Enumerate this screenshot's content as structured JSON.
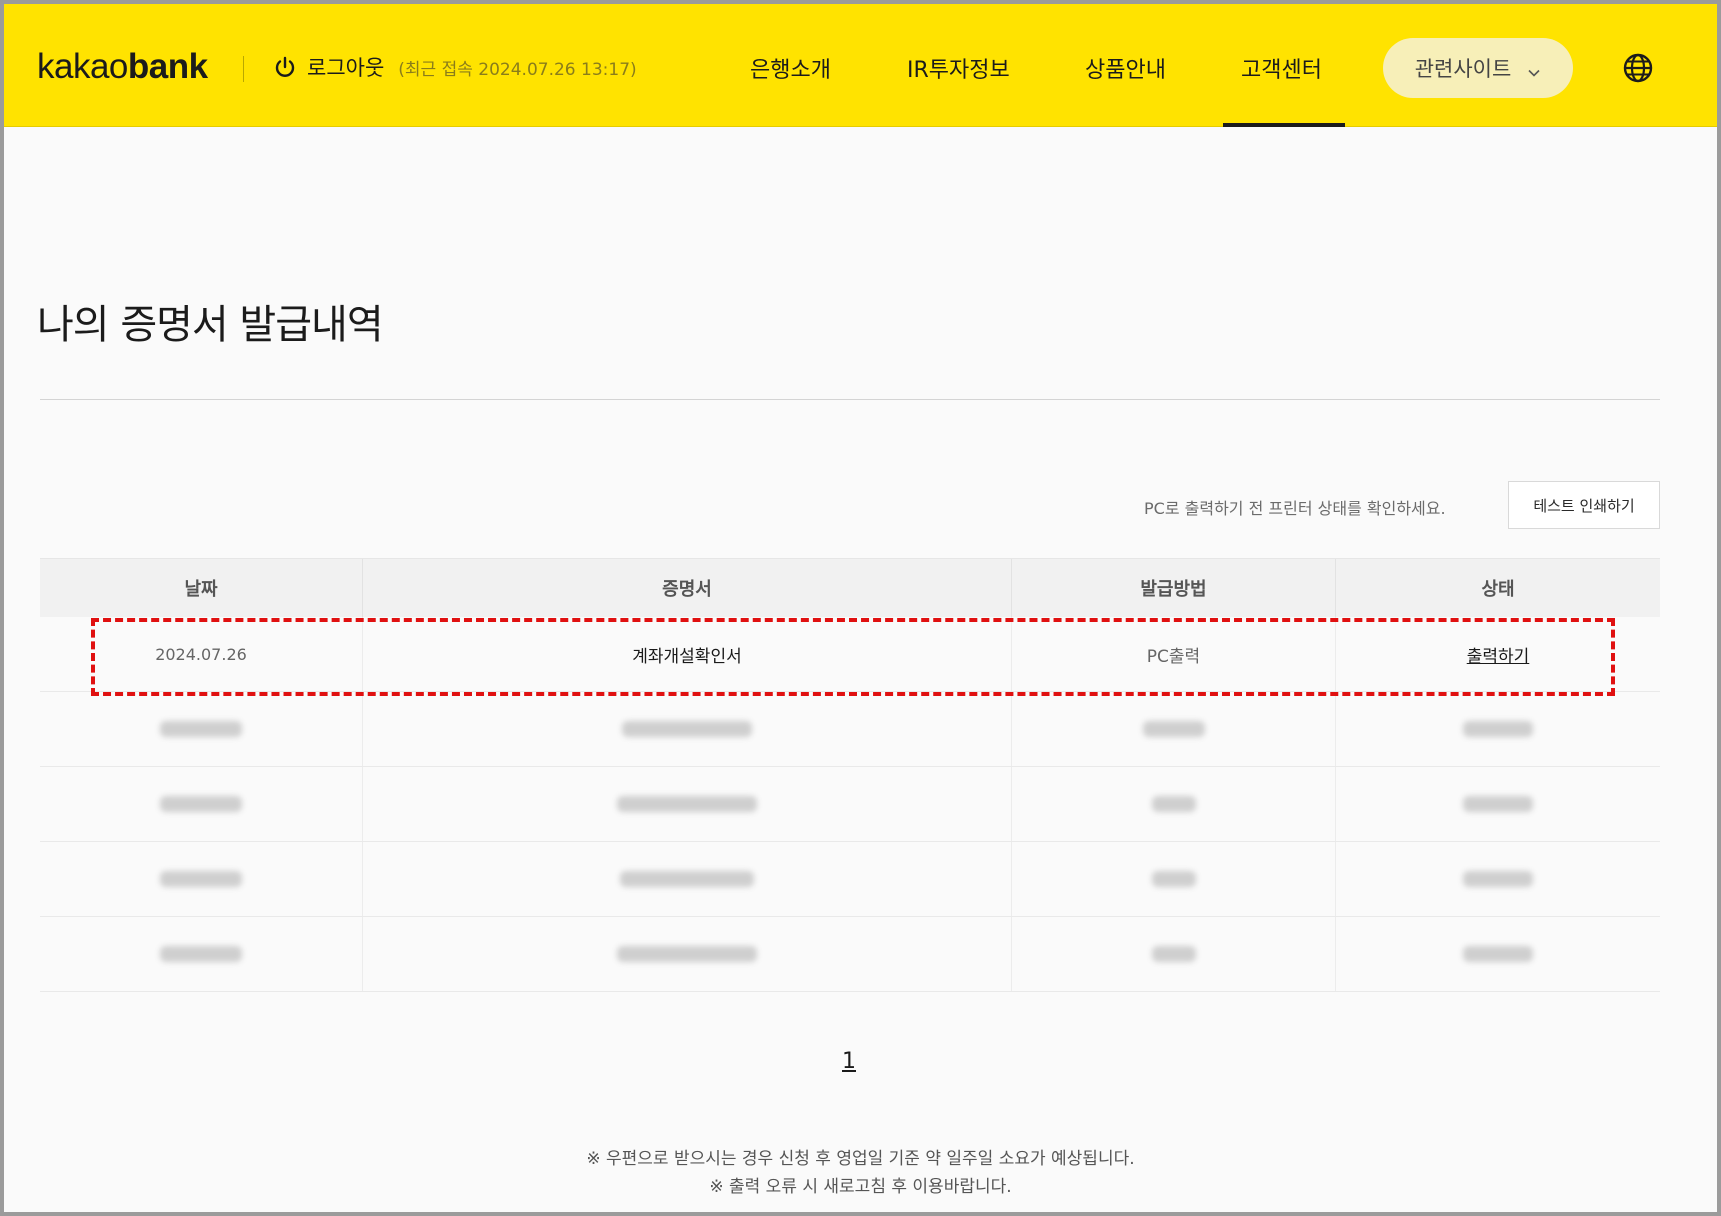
{
  "header": {
    "logo_light": "kakao",
    "logo_bold": "bank",
    "logout_label": "로그아웃",
    "last_login": "(최근 접속 2024.07.26 13:17)",
    "nav": [
      "은행소개",
      "IR투자정보",
      "상품안내",
      "고객센터"
    ],
    "active_nav": "고객센터",
    "related_sites": "관련사이트",
    "icons": {
      "logout": "power-icon",
      "related": "chevron-down-icon",
      "language": "globe-icon"
    }
  },
  "main": {
    "title": "나의 증명서 발급내역",
    "printer_hint": "PC로 출력하기 전 프린터 상태를 확인하세요.",
    "test_print": "테스트 인쇄하기"
  },
  "table": {
    "headers": [
      "날짜",
      "증명서",
      "발급방법",
      "상태"
    ],
    "rows": [
      {
        "date": "2024.07.26",
        "certificate": "계좌개설확인서",
        "method": "PC출력",
        "status": "출력하기"
      }
    ]
  },
  "pagination": {
    "current": "1"
  },
  "notes": [
    "※ 우편으로 받으시는 경우 신청 후 영업일 기준 약 일주일 소요가 예상됩니다.",
    "※ 출력 오류 시 새로고침 후 이용바랍니다."
  ],
  "colors": {
    "brand_yellow": "#ffe300",
    "highlight": "#e01010"
  }
}
